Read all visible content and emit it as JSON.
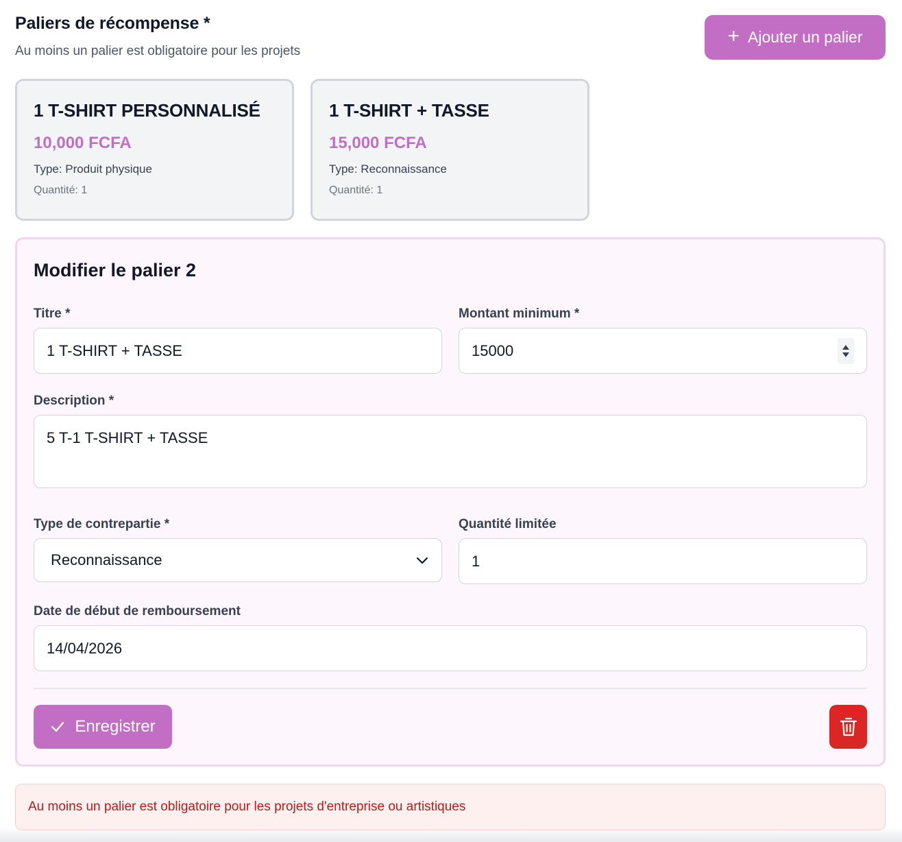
{
  "header": {
    "title": "Paliers de récompense *",
    "subtitle": "Au moins un palier est obligatoire pour les projets",
    "add_button_label": "Ajouter un palier"
  },
  "tiers": [
    {
      "title": "1 T-SHIRT PERSONNALISÉ",
      "price": "10,000 FCFA",
      "type": "Type: Produit physique",
      "quantity": "Quantité: 1"
    },
    {
      "title": "1 T-SHIRT + TASSE",
      "price": "15,000 FCFA",
      "type": "Type: Reconnaissance",
      "quantity": "Quantité: 1"
    }
  ],
  "edit_form": {
    "title": "Modifier le palier 2",
    "fields": {
      "titre": {
        "label": "Titre *",
        "value": "1 T-SHIRT + TASSE"
      },
      "montant": {
        "label": "Montant minimum *",
        "value": "15000"
      },
      "description": {
        "label": "Description *",
        "value": "5 T-1 T-SHIRT + TASSE"
      },
      "type": {
        "label": "Type de contrepartie *",
        "value": "Reconnaissance"
      },
      "quantite": {
        "label": "Quantité limitée",
        "value": "1"
      },
      "date": {
        "label": "Date de début de remboursement",
        "value": "14/04/2026"
      }
    },
    "save_label": "Enregistrer"
  },
  "error_message": "Au moins un palier est obligatoire pour les projets d'entreprise ou artistiques",
  "colors": {
    "accent": "#c26ec4",
    "danger": "#dc2626",
    "panel_bg": "#fdf6fc",
    "card_bg": "#f3f4f6"
  },
  "icons": {
    "add": "plus-icon",
    "save": "check-icon",
    "delete": "trash-icon",
    "select": "chevron-down-icon",
    "number": "spinner-icon"
  }
}
